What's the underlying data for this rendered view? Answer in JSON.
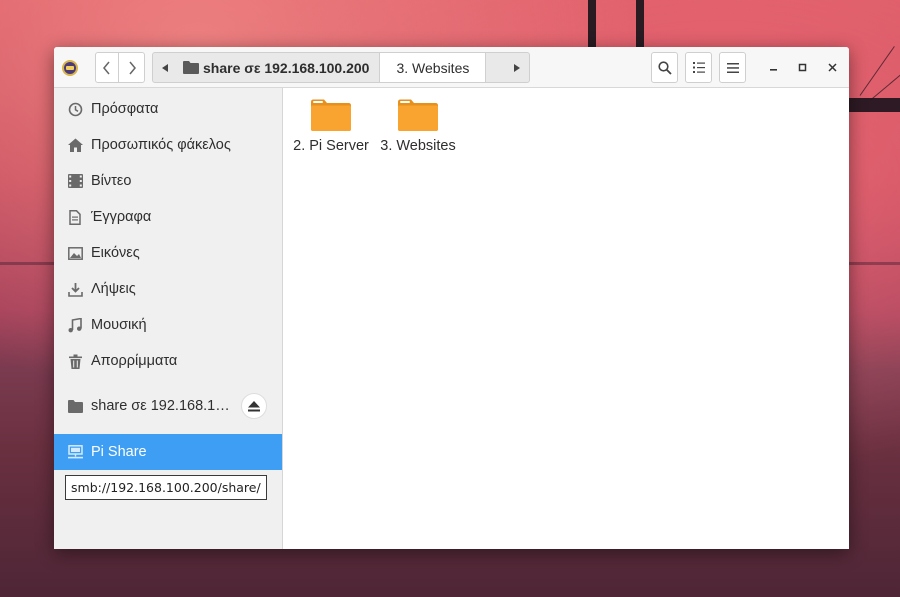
{
  "window": {
    "pathbar": {
      "segments": [
        {
          "label": "share σε 192.168.100.200"
        },
        {
          "label": "3. Websites"
        }
      ]
    },
    "icons": {
      "app": "files-app-icon",
      "back": "chevron-left-icon",
      "forward": "chevron-right-icon",
      "search": "search-icon",
      "list_view": "list-view-icon",
      "menu": "hamburger-menu-icon",
      "minimize": "minimize-icon",
      "maximize": "maximize-icon",
      "close": "close-icon"
    }
  },
  "sidebar": {
    "places": [
      {
        "label": "Πρόσφατα",
        "icon": "clock-icon"
      },
      {
        "label": "Προσωπικός φάκελος",
        "icon": "home-icon"
      },
      {
        "label": "Βίντεο",
        "icon": "film-icon"
      },
      {
        "label": "Έγγραφα",
        "icon": "document-icon"
      },
      {
        "label": "Εικόνες",
        "icon": "image-icon"
      },
      {
        "label": "Λήψεις",
        "icon": "download-icon"
      },
      {
        "label": "Μουσική",
        "icon": "music-icon"
      },
      {
        "label": "Απορρίμματα",
        "icon": "trash-icon"
      }
    ],
    "mounted": {
      "label": "share σε 192.168.1…",
      "icon": "drive-icon",
      "eject_icon": "eject-icon"
    },
    "network": {
      "label": "Pi Share",
      "icon": "network-icon",
      "selected": true
    },
    "tooltip": "smb://192.168.100.200/share/"
  },
  "main": {
    "items": [
      {
        "label": "2. Pi Server",
        "icon": "folder-icon"
      },
      {
        "label": "3. Websites",
        "icon": "folder-icon"
      }
    ]
  },
  "colors": {
    "selection": "#3d9ef3",
    "folder": "#f9a431"
  }
}
